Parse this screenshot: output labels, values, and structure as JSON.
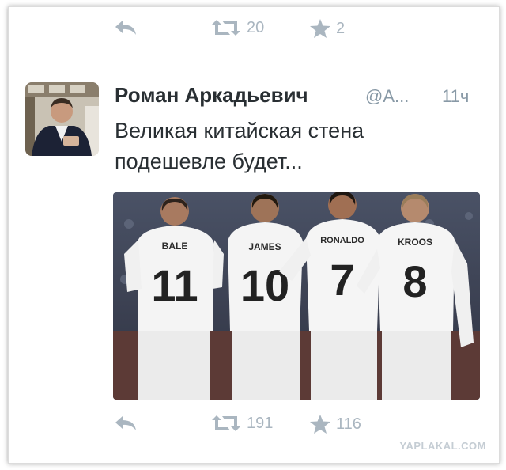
{
  "top_actions": {
    "retweets": "20",
    "favorites": "2"
  },
  "tweet": {
    "name": "Роман Аркадьевич",
    "handle": "@А...",
    "time": "11ч",
    "text": "Великая китайская стена подешевле будет..."
  },
  "photo": {
    "players": [
      {
        "name": "BALE",
        "number": "11"
      },
      {
        "name": "JAMES",
        "number": "10"
      },
      {
        "name": "RONALDO",
        "number": "7"
      },
      {
        "name": "KROOS",
        "number": "8"
      }
    ]
  },
  "bottom_actions": {
    "retweets": "191",
    "favorites": "116"
  },
  "watermark": "YAPLAKAL.COM",
  "colors": {
    "icon_gray": "#aab6c0",
    "name_text": "#292f33",
    "meta_text": "#8899a6"
  },
  "icons": [
    "reply-icon",
    "retweet-icon",
    "star-icon"
  ]
}
